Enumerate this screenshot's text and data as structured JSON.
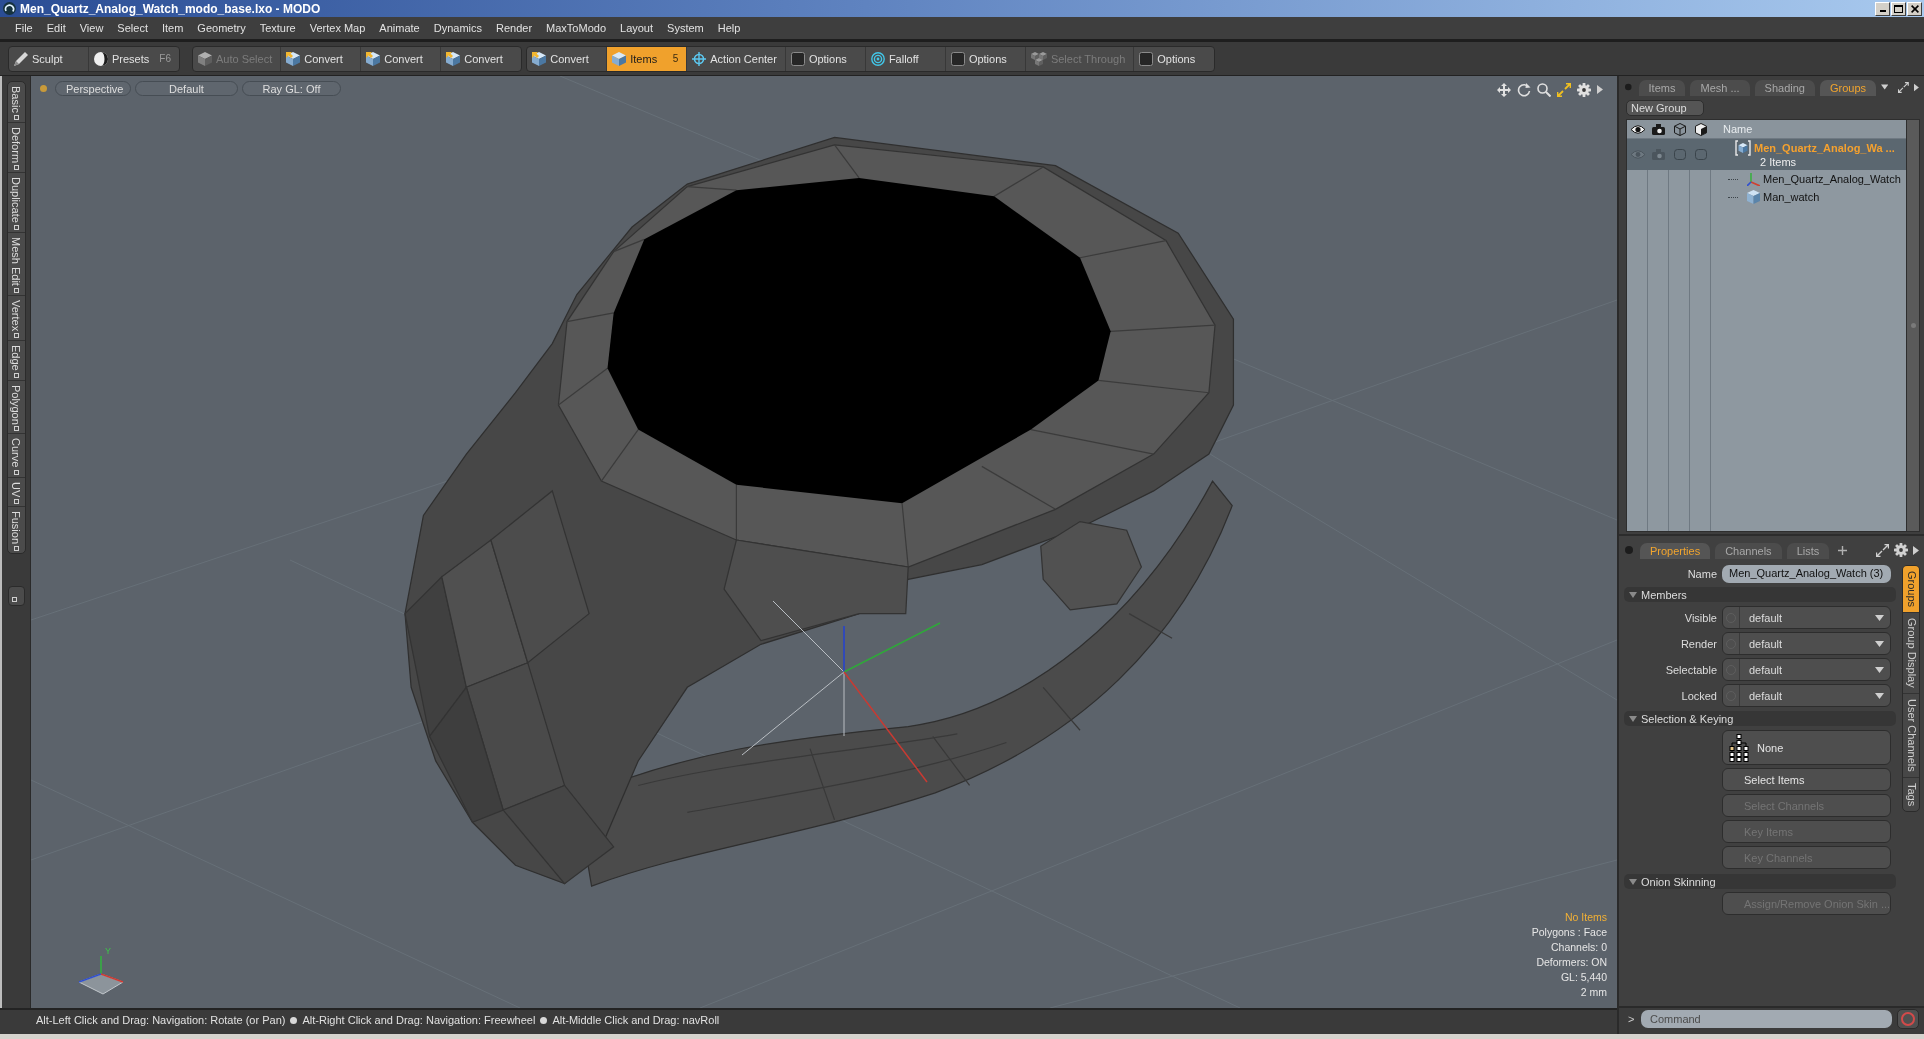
{
  "window": {
    "title": "Men_Quartz_Analog_Watch_modo_base.lxo - MODO"
  },
  "menu": [
    "File",
    "Edit",
    "View",
    "Select",
    "Item",
    "Geometry",
    "Texture",
    "Vertex Map",
    "Animate",
    "Dynamics",
    "Render",
    "MaxToModo",
    "Layout",
    "System",
    "Help"
  ],
  "toolbar": [
    {
      "items": [
        {
          "label": "Sculpt",
          "selected": false,
          "disabled": false
        },
        {
          "label": "Presets",
          "shortcut": "F6",
          "selected": false,
          "disabled": false
        }
      ]
    },
    {
      "items": [
        {
          "label": "Auto Select",
          "selected": false,
          "disabled": true
        },
        {
          "label": "Convert",
          "selected": false,
          "disabled": false
        },
        {
          "label": "Convert",
          "selected": false,
          "disabled": false
        },
        {
          "label": "Convert",
          "selected": false,
          "disabled": false
        }
      ]
    },
    {
      "items": [
        {
          "label": "Convert",
          "selected": false,
          "disabled": false
        },
        {
          "label": "Items",
          "shortcut": "5",
          "selected": true,
          "disabled": false
        },
        {
          "label": "Action Center",
          "selected": false,
          "disabled": false
        },
        {
          "label": "Options",
          "selected": false,
          "disabled": false
        },
        {
          "label": "Falloff",
          "selected": false,
          "disabled": false
        },
        {
          "label": "Options",
          "selected": false,
          "disabled": false
        },
        {
          "label": "Select Through",
          "selected": false,
          "disabled": true
        },
        {
          "label": "Options",
          "selected": false,
          "disabled": false
        }
      ]
    }
  ],
  "tool_tabs": [
    "Basic",
    "Deform",
    "Duplicate",
    "Mesh Edit",
    "Vertex",
    "Edge",
    "Polygon",
    "Curve",
    "UV",
    "Fusion"
  ],
  "viewport": {
    "header_buttons": [
      "Perspective",
      "Default",
      "Ray GL: Off"
    ],
    "axis_label": "Y",
    "info": [
      {
        "text": "No Items",
        "highlighted": true
      },
      {
        "text": "Polygons : Face",
        "highlighted": false
      },
      {
        "text": "Channels: 0",
        "highlighted": false
      },
      {
        "text": "Deformers: ON",
        "highlighted": false
      },
      {
        "text": "GL: 5,440",
        "highlighted": false
      },
      {
        "text": "2 mm",
        "highlighted": false
      }
    ]
  },
  "status_bar": {
    "hints": [
      "Alt-Left Click and Drag: Navigation: Rotate (or Pan)",
      "Alt-Right Click and Drag: Navigation: Freewheel",
      "Alt-Middle Click and Drag: navRoll"
    ]
  },
  "groups_panel": {
    "tabs": [
      {
        "label": "Items",
        "selected": false
      },
      {
        "label": "Mesh ...",
        "selected": false
      },
      {
        "label": "Shading",
        "selected": false
      },
      {
        "label": "Groups",
        "selected": true
      }
    ],
    "new_group_button": "New Group",
    "tree": {
      "columns": [
        "Name"
      ],
      "rows": [
        {
          "kind": "group",
          "name": "Men_Quartz_Analog_Wa ...",
          "subtitle": "2 Items",
          "selected": true,
          "children": [
            {
              "kind": "locator",
              "name": "Men_Quartz_Analog_Watch",
              "selected": false
            },
            {
              "kind": "mesh",
              "name": "Man_watch",
              "selected": false
            }
          ]
        }
      ]
    }
  },
  "properties_panel": {
    "tabs": [
      {
        "label": "Properties",
        "selected": true
      },
      {
        "label": "Channels",
        "selected": false
      },
      {
        "label": "Lists",
        "selected": false
      }
    ],
    "name_field": {
      "label": "Name",
      "value": "Men_Quartz_Analog_Watch (3)"
    },
    "sections": [
      {
        "title": "Members",
        "expanded": true,
        "rows": [
          {
            "kind": "dropdown",
            "label": "Visible",
            "value": "default"
          },
          {
            "kind": "dropdown",
            "label": "Render",
            "value": "default"
          },
          {
            "kind": "dropdown",
            "label": "Selectable",
            "value": "default"
          },
          {
            "kind": "dropdown",
            "label": "Locked",
            "value": "default"
          }
        ]
      },
      {
        "title": "Selection & Keying",
        "expanded": true,
        "rows": [
          {
            "kind": "icon_button",
            "label": "None",
            "disabled": false
          },
          {
            "kind": "button",
            "label": "Select Items",
            "disabled": false
          },
          {
            "kind": "button",
            "label": "Select Channels",
            "disabled": true
          },
          {
            "kind": "button",
            "label": "Key Items",
            "disabled": true
          },
          {
            "kind": "button",
            "label": "Key Channels",
            "disabled": true
          }
        ]
      },
      {
        "title": "Onion Skinning",
        "expanded": true,
        "rows": [
          {
            "kind": "button",
            "label": "Assign/Remove Onion Skin ...",
            "disabled": true
          }
        ]
      }
    ],
    "side_tabs": [
      {
        "label": "Groups",
        "selected": true
      },
      {
        "label": "Group Display",
        "selected": false
      },
      {
        "label": "User Channels",
        "selected": false
      },
      {
        "label": "Tags",
        "selected": false
      }
    ]
  },
  "command_bar": {
    "prompt": ">",
    "placeholder": "Command"
  }
}
